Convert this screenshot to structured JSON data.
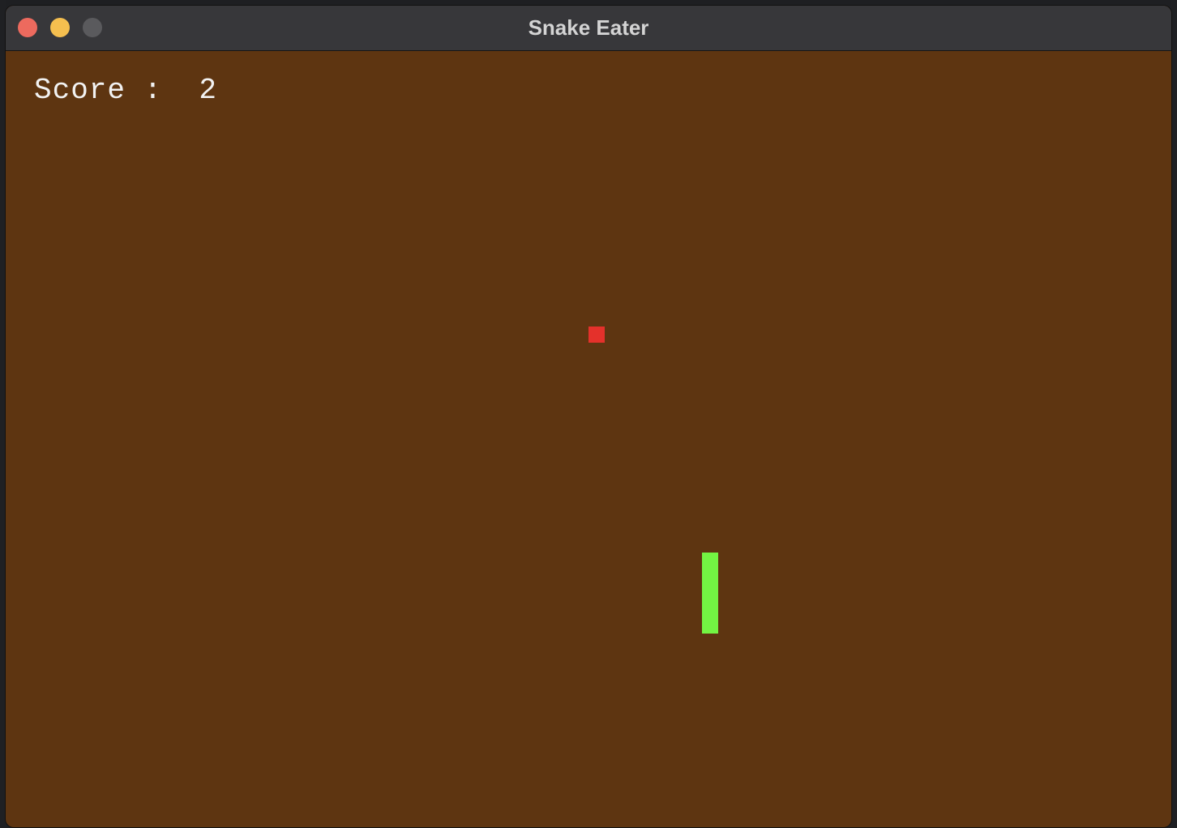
{
  "window": {
    "title": "Snake Eater",
    "buttons": {
      "close": "close-icon",
      "minimize": "minimize-icon",
      "zoom": "zoom-icon"
    }
  },
  "game": {
    "score_text": "Score :  2",
    "food_cell": [
      36,
      17
    ],
    "snake_cells": [
      [
        43,
        31
      ],
      [
        43,
        32
      ],
      [
        43,
        33
      ],
      [
        43,
        34
      ],
      [
        43,
        35
      ]
    ]
  },
  "colors": {
    "background": "#5e3511",
    "snake": "#73f543",
    "food": "#e4312b",
    "score_text": "#f2f2f2",
    "close": "#ed6a5e",
    "minimize": "#f5bf4f",
    "zoom_disabled": "#5a5a5d"
  }
}
